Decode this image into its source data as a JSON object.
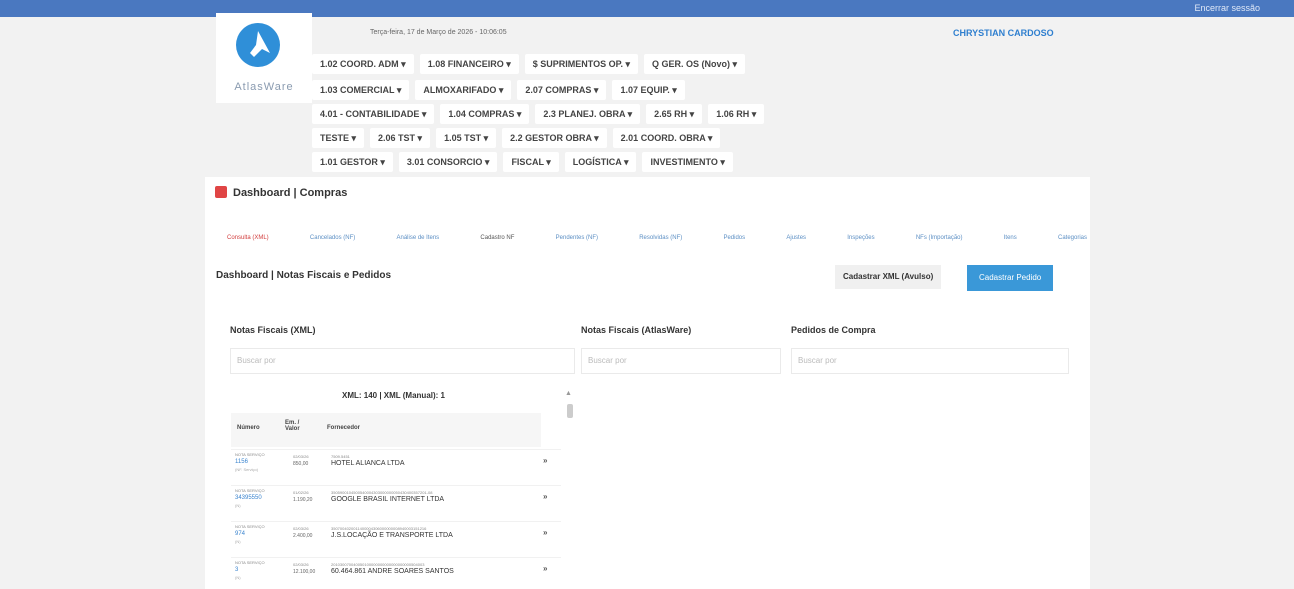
{
  "topbar": {
    "logout": "Encerrar sessão"
  },
  "logo": {
    "name": "AtlasWare"
  },
  "header": {
    "datetime": "Terça-feira, 17 de Março de 2026 - 10:06:05",
    "user": "CHRYSTIAN CARDOSO"
  },
  "menu": [
    [
      "1.02 COORD. ADM ▾",
      "1.08 FINANCEIRO ▾",
      "$ SUPRIMENTOS OP. ▾",
      "Q GER. OS (Novo) ▾"
    ],
    [
      "1.03 COMERCIAL ▾",
      "ALMOXARIFADO ▾",
      "2.07 COMPRAS ▾",
      "1.07 EQUIP. ▾"
    ],
    [
      "4.01 - CONTABILIDADE ▾",
      "1.04 COMPRAS ▾",
      "2.3 PLANEJ. OBRA ▾",
      "2.65 RH ▾",
      "1.06 RH ▾"
    ],
    [
      "TESTE ▾",
      "2.06 TST ▾",
      "1.05 TST ▾",
      "2.2 GESTOR OBRA ▾",
      "2.01 COORD. OBRA ▾"
    ],
    [
      "1.01 GESTOR ▾",
      "3.01 CONSORCIO ▾",
      "FISCAL ▾",
      "LOGÍSTICA ▾",
      "INVESTIMENTO ▾"
    ]
  ],
  "panel": {
    "title": "Dashboard | Compras"
  },
  "tabs": [
    "Consulta (XML)",
    "Cancelados (NF)",
    "Análise de Itens",
    "Cadastro NF",
    "Pendentes (NF)",
    "Resolvidas (NF)",
    "Pedidos",
    "Ajustes",
    "Inspeções",
    "NFs (Importação)",
    "Itens",
    "Categorias"
  ],
  "dashboard": {
    "title": "Dashboard | Notas Fiscais e Pedidos",
    "btn_xml": "Cadastrar XML (Avulso)",
    "btn_pedido": "Cadastrar Pedido"
  },
  "columns": {
    "nf_xml": "Notas Fiscais (XML)",
    "nf_atlas": "Notas Fiscais (AtlasWare)",
    "pedidos": "Pedidos de Compra"
  },
  "search": {
    "placeholder1": "Buscar por",
    "placeholder2": "Buscar por",
    "placeholder3": "Buscar por"
  },
  "xml_summary": "XML: 140 | XML (Manual): 1",
  "table": {
    "headers": [
      "Número",
      "Em. / Valor",
      "Fornecedor"
    ],
    "rows": [
      {
        "tipo": "NOTA SERVIÇO",
        "numero": "1156",
        "sub": "(NF. Serviço)",
        "emissao": "02/03/26",
        "valor": "850,00",
        "chave": "7509.5451",
        "fornecedor": "HOTEL ALIANCA LTDA"
      },
      {
        "tipo": "NOTA SERVIÇO",
        "numero": "34395550",
        "sub": "(N)",
        "emissao": "01/02/26",
        "valor": "1.190,20",
        "chave": "3505900104500540004303000000050430400357201-08",
        "fornecedor": "GOOGLE BRASIL INTERNET LTDA"
      },
      {
        "tipo": "NOTA SERVIÇO",
        "numero": "974",
        "sub": "(N)",
        "emissao": "02/03/26",
        "valor": "2.400,00",
        "chave": "3507004020011400004306000000008940003151216",
        "fornecedor": "J.S.LOCAÇÃO E TRANSPORTE LTDA"
      },
      {
        "tipo": "NOTA SERVIÇO",
        "numero": "3",
        "sub": "(N)",
        "emissao": "02/03/26",
        "valor": "12.100,00",
        "chave": "201030070040050100000000000000000000504003",
        "fornecedor": "60.464.861 ANDRE SOARES SANTOS"
      }
    ]
  }
}
